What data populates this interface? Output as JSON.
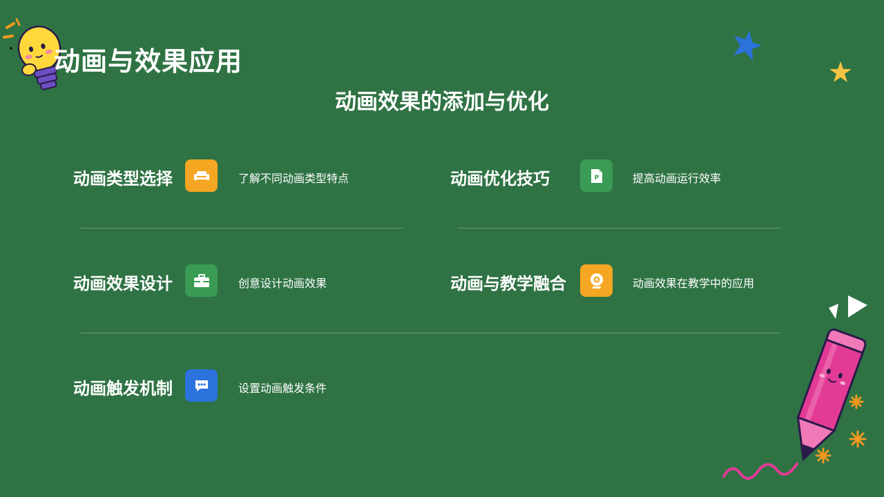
{
  "page": {
    "title": "动画与效果应用",
    "subtitle": "动画效果的添加与优化"
  },
  "items": [
    {
      "label": "动画类型选择",
      "icon": "sofa-icon",
      "icon_color": "#f5a623",
      "description": "了解不同动画类型特点"
    },
    {
      "label": "动画优化技巧",
      "icon": "document-p-icon",
      "icon_color": "#3a9b55",
      "description": "提高动画运行效率"
    },
    {
      "label": "动画效果设计",
      "icon": "briefcase-icon",
      "icon_color": "#3a9b55",
      "description": "创意设计动画效果"
    },
    {
      "label": "动画与教学融合",
      "icon": "webcam-icon",
      "icon_color": "#f5a623",
      "description": "动画效果在教学中的应用"
    },
    {
      "label": "动画触发机制",
      "icon": "chat-icon",
      "icon_color": "#2b72db",
      "description": "设置动画触发条件"
    }
  ],
  "colors": {
    "background": "#2f7344",
    "star_blue": "#2b72db",
    "star_yellow": "#f5c242",
    "pencil_pink": "#e33a96",
    "accent_orange": "#f39a1f"
  }
}
